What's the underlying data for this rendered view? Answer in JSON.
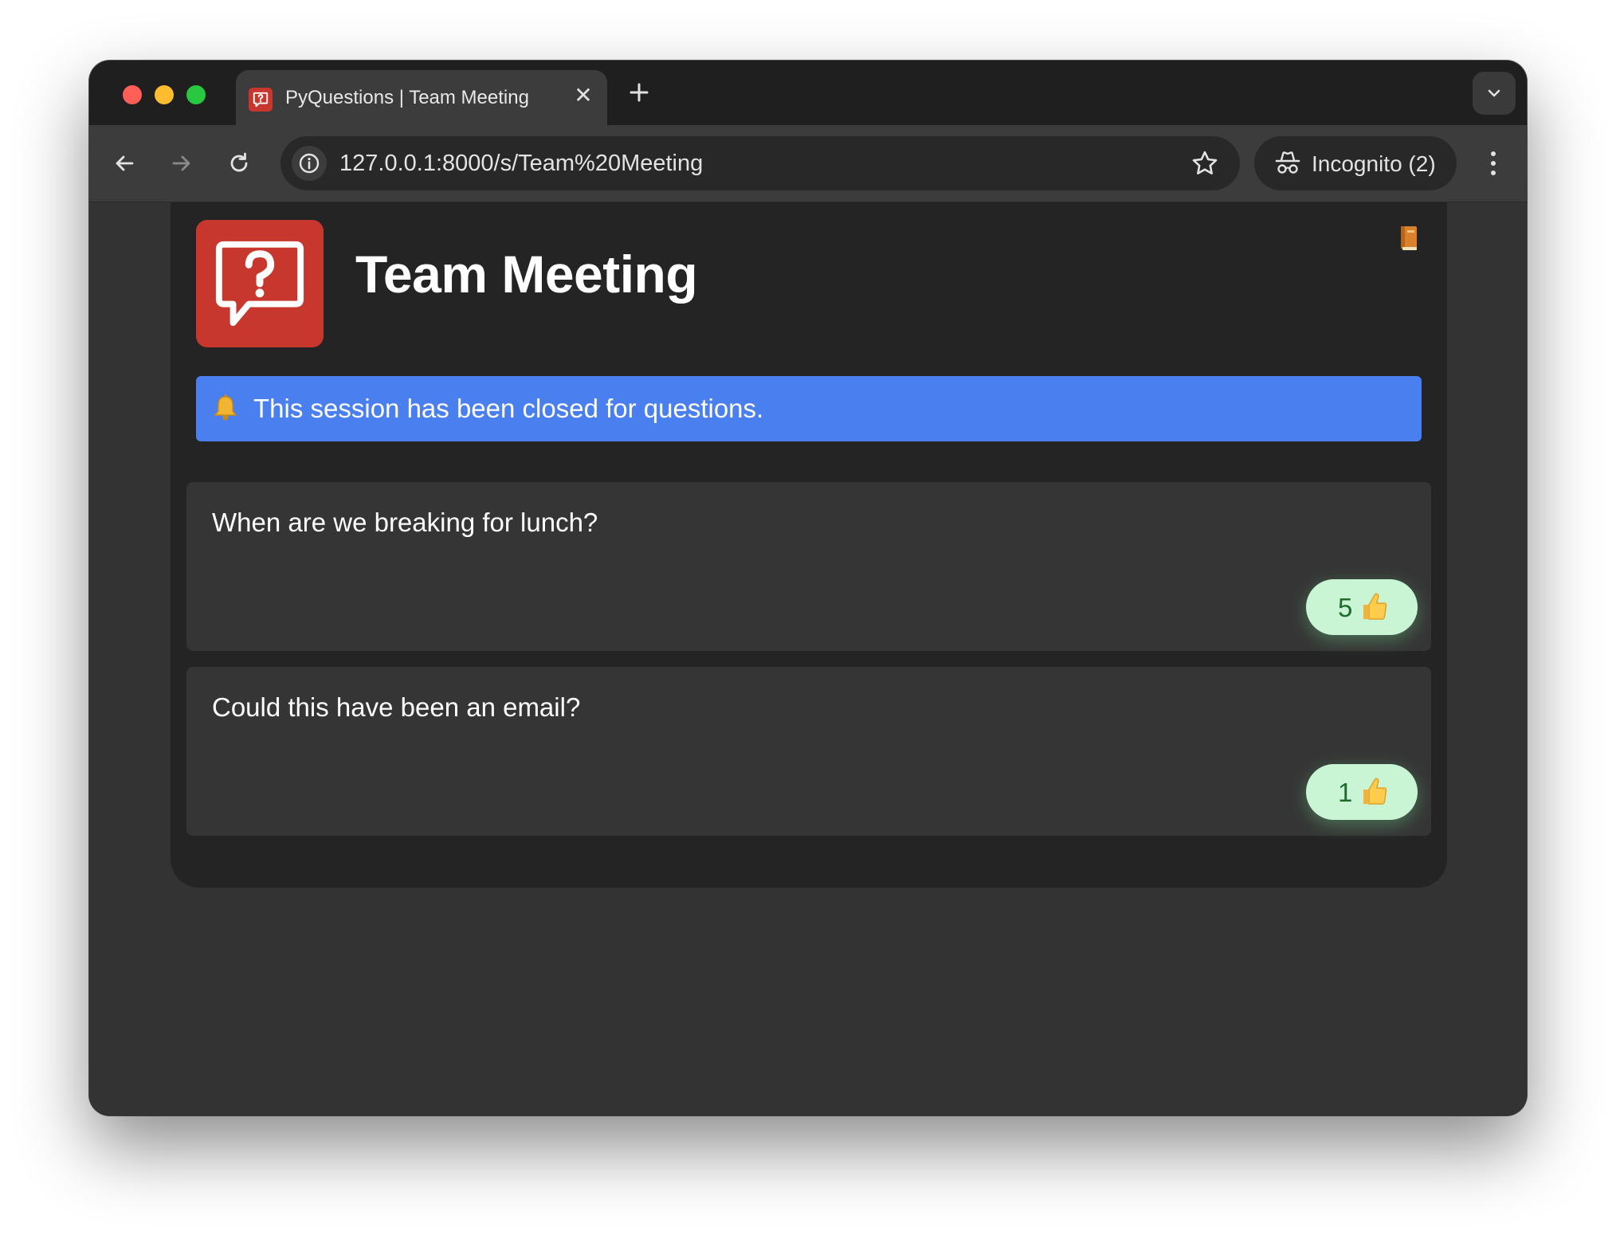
{
  "browser": {
    "tab": {
      "title": "PyQuestions | Team Meeting",
      "close_glyph": "✕"
    },
    "url": "127.0.0.1:8000/s/Team%20Meeting",
    "profile": "Incognito (2)"
  },
  "page": {
    "title": "Team Meeting",
    "notice": "This session has been closed for questions.",
    "questions": [
      {
        "text": "When are we breaking for lunch?",
        "votes": "5"
      },
      {
        "text": "Could this have been an email?",
        "votes": "1"
      }
    ]
  },
  "colors": {
    "brand": "#c8372d",
    "notice_bg": "#4a7fef",
    "vote_bg": "#c9f5d4",
    "page_bg": "#333333",
    "container_bg": "#242424"
  },
  "icons": [
    "help-question-icon",
    "book-icon",
    "bell-icon",
    "thumbs-up-icon"
  ]
}
